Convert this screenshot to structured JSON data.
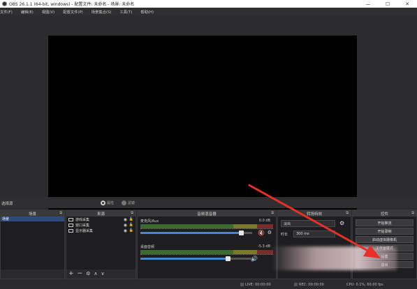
{
  "window": {
    "title": "OBS 26.1.1 (64-bit, windows) - 配置文件: 未命名 - 场景: 未命名",
    "minimize": "—",
    "maximize": "☐",
    "close": "✕"
  },
  "menu": [
    "文件(F)",
    "编辑(E)",
    "视图(V)",
    "配置文件(P)",
    "场景集合(S)",
    "工具(T)",
    "帮助(H)"
  ],
  "context_bar": {
    "label": "选择源",
    "properties": "属性",
    "filters": "滤镜"
  },
  "docks": {
    "scenes": {
      "title": "场景",
      "items": [
        "场景"
      ]
    },
    "sources": {
      "title": "来源",
      "items": [
        "游戏采集",
        "窗口采集",
        "显示器采集"
      ]
    },
    "mixer": {
      "title": "音频混音器",
      "channels": [
        {
          "name": "麦克风/Aux",
          "db": "0.0 dB",
          "level": 0.9
        },
        {
          "name": "桌面音频",
          "db": "-5.3 dB",
          "level": 0.78
        }
      ]
    },
    "transitions": {
      "title": "转场特效",
      "type": "淡出",
      "duration_label": "时长",
      "duration": "300 ms"
    },
    "controls": {
      "title": "控件",
      "buttons": [
        "开始推流",
        "开始录制",
        "启动虚拟摄像机",
        "工作室模式",
        "设置",
        "退出"
      ]
    }
  },
  "status": {
    "live": "LIVE: 00:00:00",
    "rec": "REC: 00:00:00",
    "cpu": "CPU: 0.1%, 60.00 fps"
  },
  "colors": {
    "accent_blue": "#4a86c8",
    "arrow_red": "#e8302a",
    "mute_red": "#e02020"
  }
}
